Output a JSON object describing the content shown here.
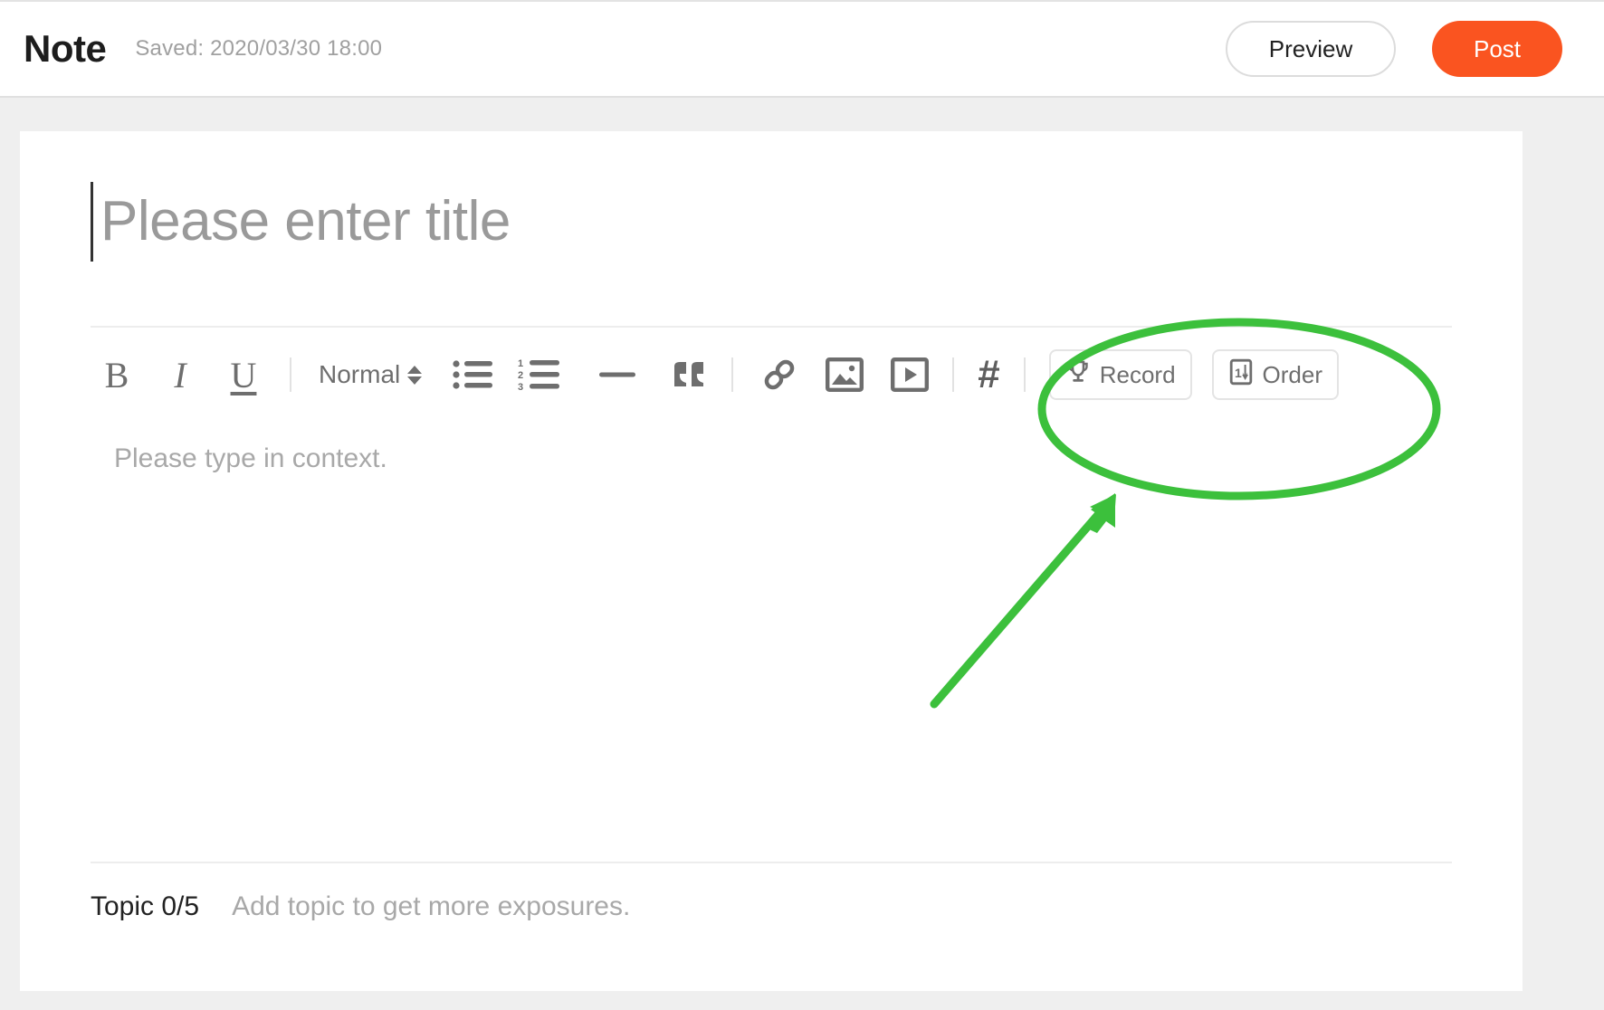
{
  "header": {
    "app_title": "Note",
    "saved_text": "Saved: 2020/03/30 18:00",
    "preview_label": "Preview",
    "post_label": "Post",
    "post_color": "#fa5420"
  },
  "editor": {
    "title_placeholder": "Please enter title",
    "body_placeholder": "Please type in context.",
    "toolbar": {
      "bold_label": "B",
      "italic_label": "I",
      "underline_label": "U",
      "format_label": "Normal",
      "hash_label": "#",
      "record_label": "Record",
      "order_label": "Order"
    }
  },
  "topic": {
    "label": "Topic 0/5",
    "hint": "Add topic to get more exposures."
  },
  "annotation": {
    "color": "#3cc03c",
    "shapes": "ellipse-highlight-and-arrow"
  }
}
